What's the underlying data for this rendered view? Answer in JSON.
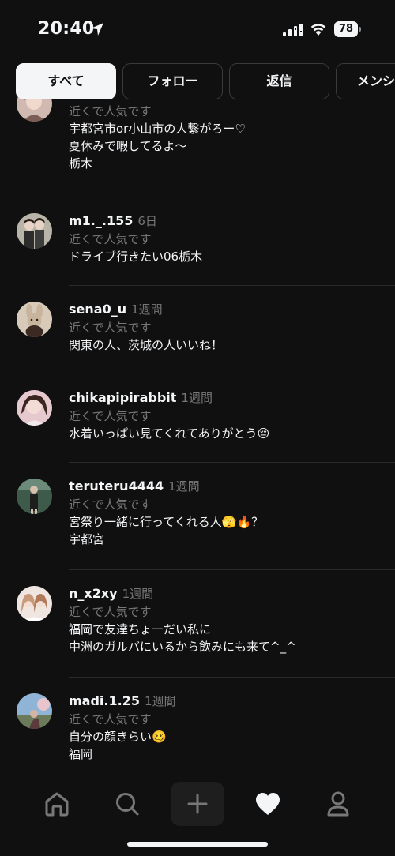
{
  "status_bar": {
    "time": "20:40",
    "battery": "78"
  },
  "tabs": [
    {
      "label": "すべて",
      "active": true
    },
    {
      "label": "フォロー",
      "active": false
    },
    {
      "label": "返信",
      "active": false
    },
    {
      "label": "メンション",
      "active": false
    }
  ],
  "feed": {
    "items": [
      {
        "username": "",
        "time": "",
        "subtitle": "近くで人気です",
        "lines": [
          "宇都宮市or小山市の人繋がろー♡",
          "夏休みで暇してるよ〜",
          "栃木"
        ]
      },
      {
        "username": "m1._.155",
        "time": "6日",
        "subtitle": "近くで人気です",
        "lines": [
          "ドライブ行きたい06栃木"
        ]
      },
      {
        "username": "sena0_u",
        "time": "1週間",
        "subtitle": "近くで人気です",
        "lines": [
          "関東の人、茨城の人いいね！"
        ]
      },
      {
        "username": "chikapipirabbit",
        "time": "1週間",
        "subtitle": "近くで人気です",
        "lines": [
          "水着いっぱい見てくれてありがとう😔"
        ]
      },
      {
        "username": "teruteru4444",
        "time": "1週間",
        "subtitle": "近くで人気です",
        "lines": [
          "宮祭り一緒に行ってくれる人🫣🔥？",
          "宇都宮"
        ]
      },
      {
        "username": "n_x2xy",
        "time": "1週間",
        "subtitle": "近くで人気です",
        "lines": [
          "福岡で友達ちょーだい私に",
          "中洲のガルバにいるから飲みにも来て^_^"
        ]
      },
      {
        "username": "madi.1.25",
        "time": "1週間",
        "subtitle": "近くで人気です",
        "lines": [
          "自分の顔きらい🥴",
          " 福岡"
        ]
      }
    ]
  },
  "bottom_nav": {
    "items": [
      {
        "icon": "home-icon"
      },
      {
        "icon": "search-icon"
      },
      {
        "icon": "plus-icon"
      },
      {
        "icon": "heart-icon"
      },
      {
        "icon": "profile-icon"
      }
    ]
  },
  "colors": {
    "background": "#101010",
    "text_primary": "#f3f5f7",
    "text_secondary": "#777777",
    "divider": "#2a2a2a"
  }
}
